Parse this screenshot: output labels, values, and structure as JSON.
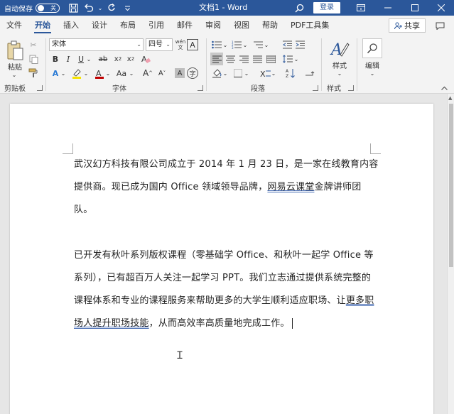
{
  "titlebar": {
    "autosave_label": "自动保存",
    "autosave_state": "关",
    "doc_title": "文档1 - Word",
    "signin_label": "登录"
  },
  "tabs": [
    {
      "label": "文件"
    },
    {
      "label": "开始"
    },
    {
      "label": "插入"
    },
    {
      "label": "设计"
    },
    {
      "label": "布局"
    },
    {
      "label": "引用"
    },
    {
      "label": "邮件"
    },
    {
      "label": "审阅"
    },
    {
      "label": "视图"
    },
    {
      "label": "帮助"
    },
    {
      "label": "PDF工具集"
    }
  ],
  "active_tab": "开始",
  "share_label": "共享",
  "ribbon": {
    "clipboard": {
      "paste_label": "粘贴",
      "group_label": "剪贴板"
    },
    "font": {
      "font_name": "宋体",
      "font_size": "四号",
      "wen_label": "wén",
      "a_box": "A",
      "group_label": "字体",
      "aa_label": "Aa",
      "grow_font": "A",
      "shrink_font": "A",
      "char_shade": "A",
      "enclose": "字"
    },
    "paragraph": {
      "group_label": "段落"
    },
    "styles": {
      "label": "样式",
      "group_label": "样式"
    },
    "editing": {
      "label": "编辑"
    }
  },
  "document": {
    "p1_before": "武汉幻方科技有限公司成立于 2014 年 1 月 23 日，是一家在线教育内容提供商。现已成为国内 Office 领域领导品牌，",
    "p1_link": "网易云课堂",
    "p1_after": "金牌讲师团队。",
    "p2_before": "已开发有秋叶系列版权课程（零基础学 Office、和秋叶一起学 Office 等系列），已有超百万人关注一起学习 PPT。我们立志通过提供系统完整的课程体系和专业的课程服务来帮助更多的大学生顺利适应职场、让",
    "p2_link": "更多职场人提升职场技能",
    "p2_after": "，从而高效率高质量地完成工作。"
  },
  "colors": {
    "brand": "#2b579a",
    "accent_underline": "#4a6fb5",
    "highlight": "#f5e200",
    "font_color": "#c00000"
  }
}
